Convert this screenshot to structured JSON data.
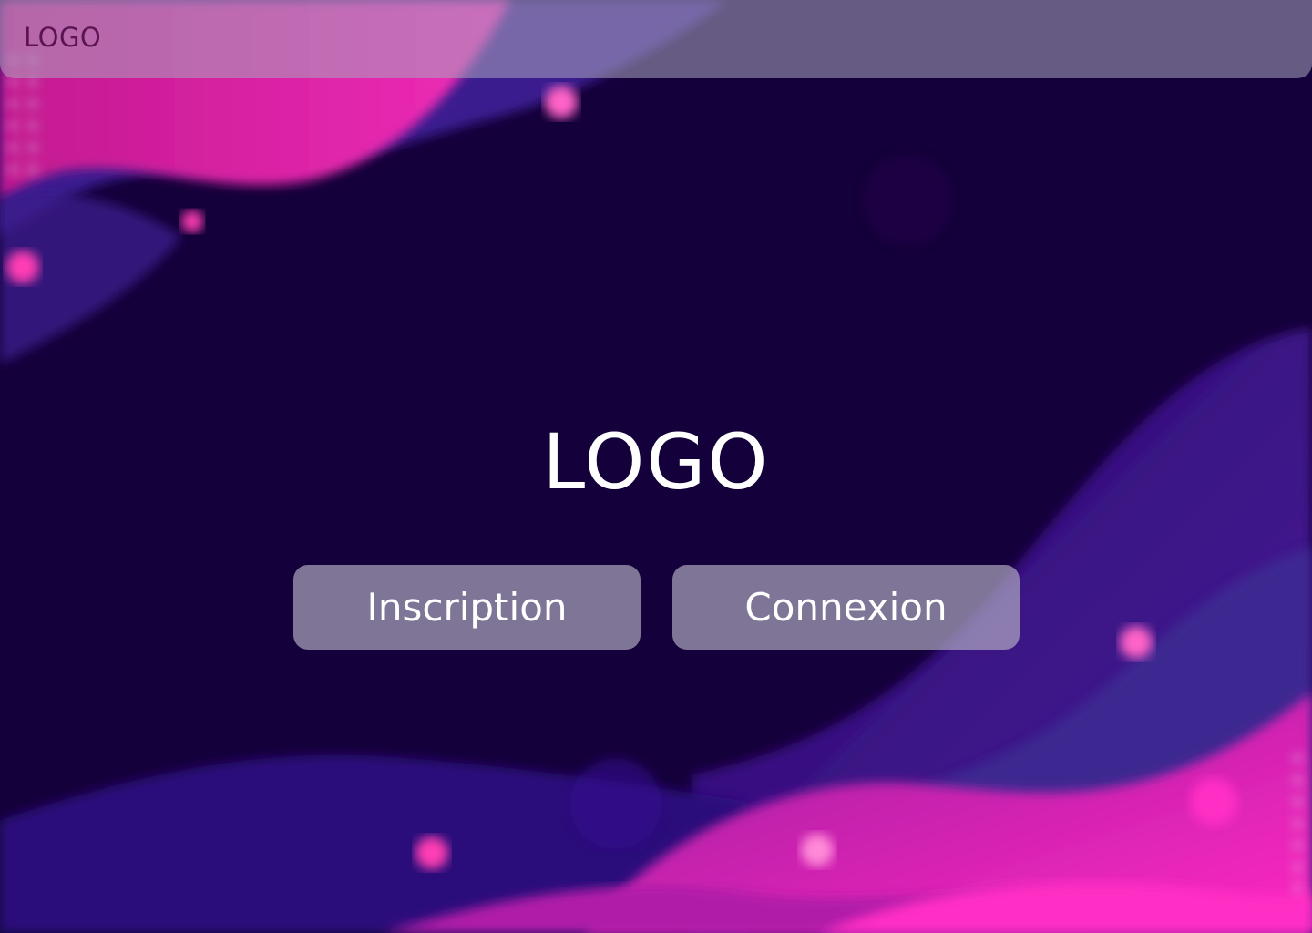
{
  "header": {
    "logo_text": "LOGO"
  },
  "hero": {
    "logo_text": "LOGO"
  },
  "actions": {
    "signup_label": "Inscription",
    "login_label": "Connexion"
  },
  "colors": {
    "background": "#14003a",
    "accent_pink": "#e91e9c",
    "accent_purple": "#3a0a8a"
  }
}
